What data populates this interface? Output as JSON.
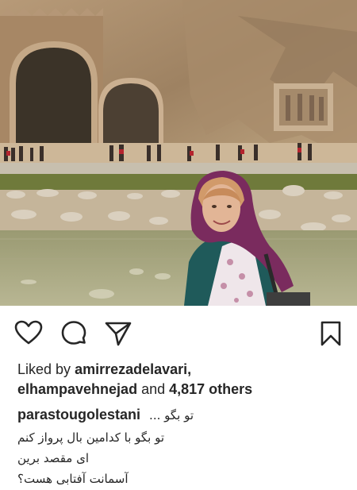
{
  "post": {
    "liked_by_label": "Liked by",
    "liked_by_user1": "amirrezadelavari,",
    "liked_by_user2": "elhampavehnejad",
    "and_label": "and",
    "others_count": "4,817 others",
    "caption_user": "parastougolestani",
    "caption_line1": "تو بگو ...",
    "caption_line2": "تو بگو با کدامین بال پرواز کنم",
    "caption_line3": "ای مقصد برین",
    "caption_line4": "آسمانت آفتابی هست؟"
  },
  "icons": {
    "like": "heart-outline",
    "comment": "speech-bubble",
    "share": "paper-plane",
    "save": "bookmark"
  },
  "colors": {
    "text": "#262626",
    "scarf": "#7a2b5e"
  }
}
